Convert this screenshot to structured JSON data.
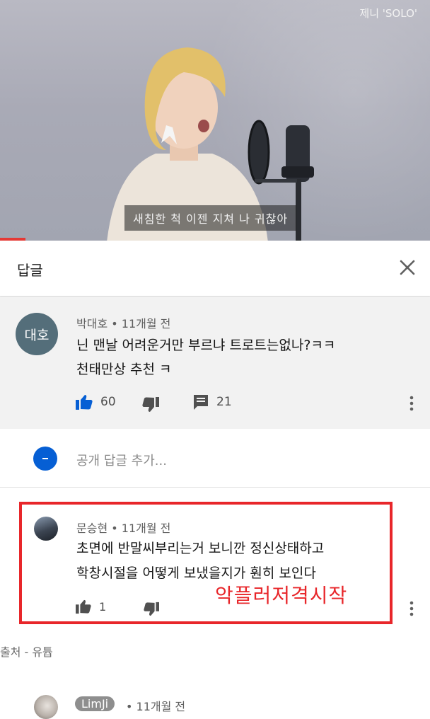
{
  "video": {
    "watermark": "제니 'SOLO'",
    "subtitle": "새침한 척 이젠 지쳐 나 귀찮아",
    "progress": 0.06
  },
  "panel": {
    "title": "답글",
    "close_icon": "close-icon"
  },
  "main_comment": {
    "avatar_text": "대호",
    "meta": "박대호 • 11개월 전",
    "lines": [
      "닌 맨날 어려운거만 부르냐 트로트는없나?ㅋㅋ",
      "천태만상 추천 ㅋ"
    ],
    "likes": "60",
    "replies": "21"
  },
  "add_reply": {
    "placeholder": "공개 답글 추가..."
  },
  "reply": {
    "meta": "문승현 • 11개월 전",
    "lines": [
      "초면에 반말씨부리는거 보니깐 정신상태하고",
      "학창시절을 어떻게 보냈을지가 훤히 보인다"
    ],
    "likes": "1",
    "annotation": "악플러저격시작"
  },
  "source_note": "출처 - 유튭",
  "next_reply": {
    "author_chip": "LimJi",
    "meta": "• 11개월 전"
  },
  "colors": {
    "accent_blue": "#065fd4",
    "highlight_red": "#e8262a",
    "progress_red": "#e53935"
  }
}
